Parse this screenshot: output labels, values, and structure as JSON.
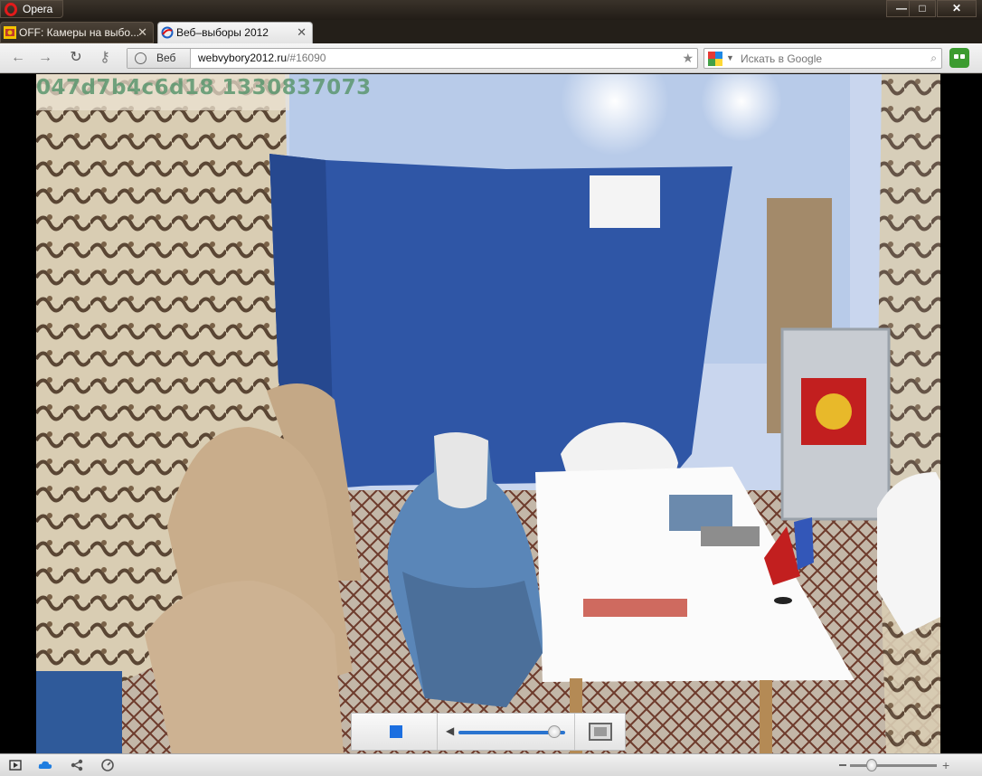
{
  "window": {
    "app_button_label": "Opera",
    "controls": {
      "minimize": "—",
      "maximize": "□",
      "close": "✕"
    }
  },
  "tabs": [
    {
      "label": "OFF: Камеры на выбо...",
      "active": false
    },
    {
      "label": "Веб–выборы 2012",
      "active": true
    }
  ],
  "tab_close_glyph": "✕",
  "new_tab_glyph": "+",
  "nav": {
    "back": "←",
    "forward": "→",
    "reload": "↻",
    "key": "⚷",
    "address_badge": "Веб",
    "address_host": "webvybory2012.ru",
    "address_path": "/#16090",
    "bookmark_glyph": "★"
  },
  "search": {
    "placeholder": "Искать в Google",
    "dropdown_glyph": "▼",
    "go_glyph": "⌕"
  },
  "video": {
    "overlay_stamp": "047d7b4c6d18 1330837073",
    "volume_level": 0.9,
    "volume_glyph": "◀"
  },
  "status": {
    "zoom_plus": "+",
    "zoom_level": 0.25
  },
  "colors": {
    "chrome_dark": "#241f19",
    "accent_blue": "#1c6fe0",
    "opera_red": "#e21b1b",
    "unite_green": "#3c9b2f"
  }
}
